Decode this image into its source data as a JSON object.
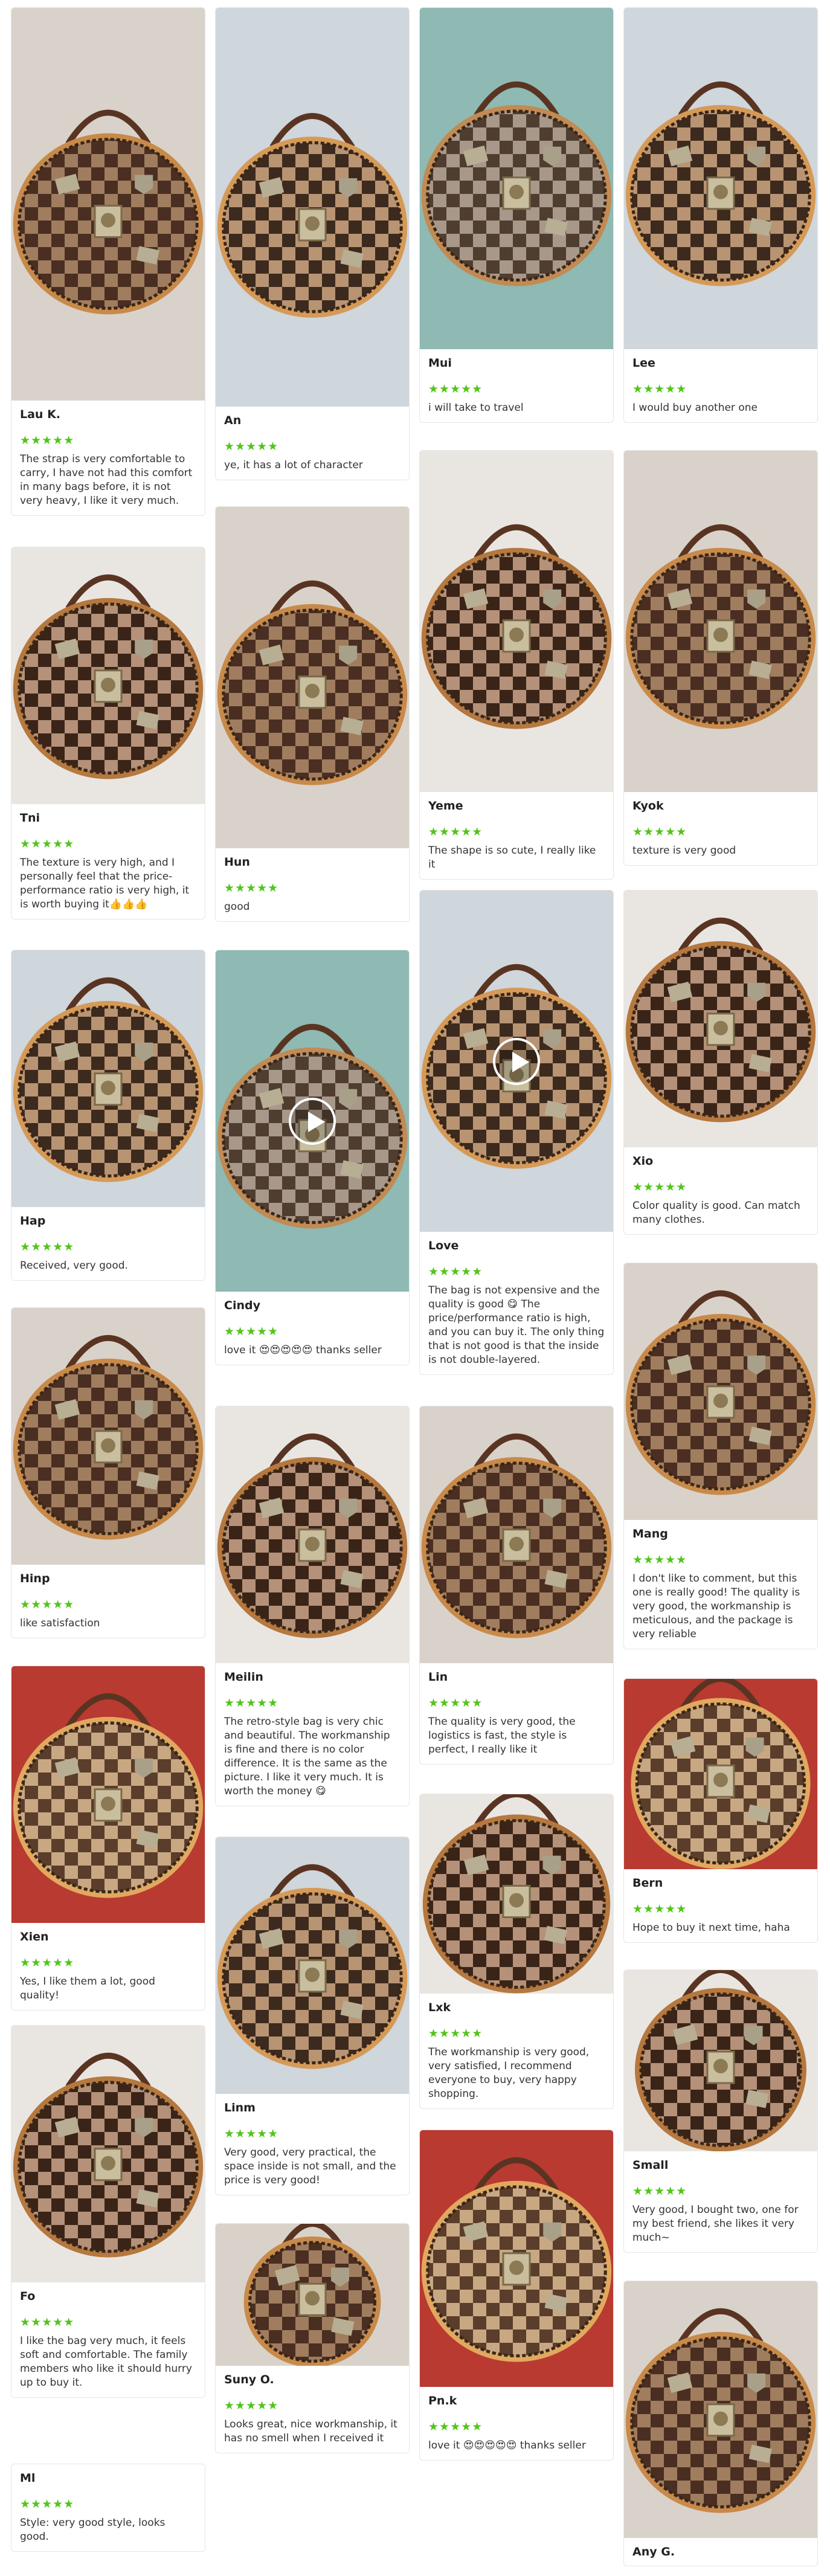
{
  "accent_star_color": "#52c41a",
  "stars_text": "★★★★★",
  "reviews": [
    {
      "name": "Lau K.",
      "text": "The strap is very comfortable to carry, I have not had this comfort in many bags before, it is not very heavy, I like it very much.",
      "icon": "shoulder-strap-photo",
      "video": false
    },
    {
      "name": "Tni",
      "text": "The texture is very high, and I personally feel that the price-performance ratio is very high, it is worth buying it👍👍👍",
      "icon": "bag-scarf-photo",
      "video": false
    },
    {
      "name": "Hap",
      "text": "Received, very good.",
      "icon": "bag-photo",
      "video": false
    },
    {
      "name": "Hinp",
      "text": "like satisfaction",
      "icon": "bag-photo",
      "video": false
    },
    {
      "name": "Xien",
      "text": "Yes, I like them a lot, good quality!",
      "icon": "bag-store-photo",
      "video": false
    },
    {
      "name": "Fo",
      "text": "I like the bag very much, it feels soft and comfortable. The family members who like it should hurry up to buy it.",
      "icon": "bag-photo",
      "video": false
    },
    {
      "name": "Ml",
      "text": "Style: very good style, looks good.",
      "icon": "",
      "video": false
    },
    {
      "name": "An",
      "text": "ye,   it has a lot of character",
      "icon": "bag-photo",
      "video": false
    },
    {
      "name": "Hun",
      "text": "good",
      "icon": "bag-photo",
      "video": false
    },
    {
      "name": "Cindy",
      "text": "love it 😍😍😍😍😍 thanks seller",
      "icon": "bag-video",
      "video": true
    },
    {
      "name": "Meilin",
      "text": "The retro-style bag is very chic and beautiful. The workmanship is fine and there is no color difference. It is the same as the picture. I like it very much. It is worth the money 😋",
      "icon": "bag-photo",
      "video": false
    },
    {
      "name": "Linm",
      "text": "Very good, very practical, the space inside is not small, and the price is very good!",
      "icon": "bag-photo",
      "video": false
    },
    {
      "name": "Suny O.",
      "text": "Looks great, nice workmanship, it has no smell when I received it",
      "icon": "bag-photo",
      "video": false
    },
    {
      "name": "Mui",
      "text": "i will take to travel",
      "icon": "bag-open-photo",
      "video": false
    },
    {
      "name": "Yeme",
      "text": "The shape is so cute, I really like it",
      "icon": "bag-photo",
      "video": false
    },
    {
      "name": "Love",
      "text": "The bag is not expensive and the quality is good 😋 The price/performance ratio is high, and you can buy it. The only thing that is not good is that the inside is not double-layered.",
      "icon": "bag-video",
      "video": true
    },
    {
      "name": "Lin",
      "text": "The quality is very good, the logistics is fast, the style is perfect, I really like it",
      "icon": "bag-photo",
      "video": false
    },
    {
      "name": "Lxk",
      "text": "The workmanship is very good, very satisfied, I recommend everyone to buy, very happy shopping.",
      "icon": "bag-photo",
      "video": false
    },
    {
      "name": "Pn.k",
      "text": "love it 😍😍😍😍😍 thanks seller",
      "icon": "bag-photo",
      "video": false
    },
    {
      "name": "Lee",
      "text": "I would buy another one",
      "icon": "bag-photo",
      "video": false
    },
    {
      "name": "Kyok",
      "text": "texture is very good",
      "icon": "bag-photo",
      "video": false
    },
    {
      "name": "Xio",
      "text": "Color quality is good. Can match many clothes.",
      "icon": "bag-photo",
      "video": false
    },
    {
      "name": "Mang",
      "text": "I don't like to comment, but this one is really good! The quality is very good, the workmanship is meticulous, and the package is very reliable",
      "icon": "bag-photo",
      "video": false
    },
    {
      "name": "Bern",
      "text": "Hope to buy it next time, haha",
      "icon": "bag-photo",
      "video": false
    },
    {
      "name": "Small",
      "text": "Very good, I bought two, one for my best friend, she likes it very much~",
      "icon": "bag-photo",
      "video": false
    },
    {
      "name": "Any G.",
      "text": "",
      "icon": "bag-photo",
      "video": false
    }
  ]
}
